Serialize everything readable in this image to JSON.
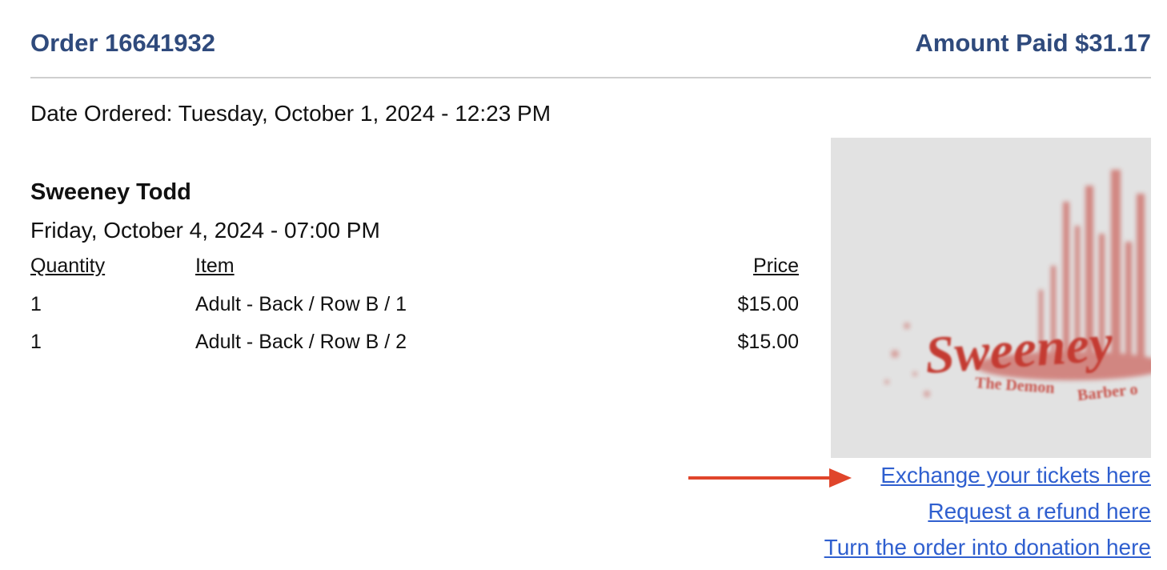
{
  "order": {
    "title": "Order 16641932",
    "amount_paid": "Amount Paid $31.17",
    "date_ordered": "Date Ordered: Tuesday, October 1, 2024 - 12:23 PM"
  },
  "event": {
    "title": "Sweeney Todd",
    "date": "Friday, October 4, 2024 - 07:00 PM"
  },
  "table": {
    "headers": {
      "quantity": "Quantity",
      "item": "Item",
      "price": "Price"
    },
    "rows": [
      {
        "quantity": "1",
        "item": "Adult - Back / Row B / 1",
        "price": "$15.00"
      },
      {
        "quantity": "1",
        "item": "Adult - Back / Row B / 2",
        "price": "$15.00"
      }
    ]
  },
  "poster": {
    "title": "Sweeney",
    "subtitle_1": "The Demon",
    "subtitle_2": "Barber o"
  },
  "links": {
    "exchange": "Exchange your tickets here",
    "refund": "Request a refund here",
    "donation": "Turn the order into donation here"
  },
  "colors": {
    "heading": "#2f4a7c",
    "link": "#2f5fcf",
    "arrow": "#e0452b",
    "poster_red": "#c43a30"
  }
}
